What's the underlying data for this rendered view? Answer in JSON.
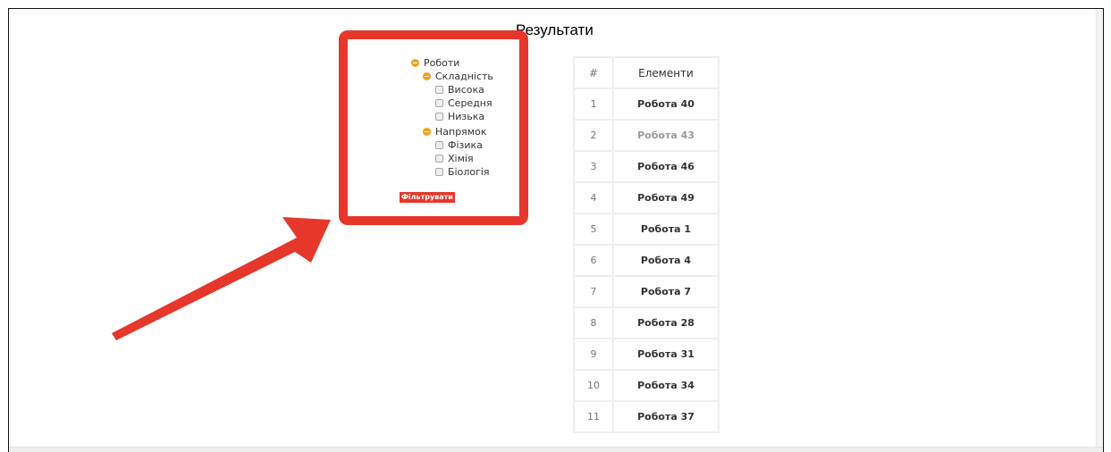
{
  "page": {
    "title": "Результати"
  },
  "filter_tree": {
    "root_label": "Роботи",
    "groups": [
      {
        "label": "Складність",
        "options": [
          "Висока",
          "Середня",
          "Низька"
        ]
      },
      {
        "label": "Напрямок",
        "options": [
          "Фізика",
          "Хімія",
          "Біологія"
        ]
      }
    ],
    "filter_button_label": "Фільтрувати"
  },
  "table": {
    "headers": [
      "#",
      "Елементи"
    ],
    "rows": [
      {
        "num": "1",
        "item": "Робота 40"
      },
      {
        "num": "2",
        "item": "Робота 43"
      },
      {
        "num": "3",
        "item": "Робота 46"
      },
      {
        "num": "4",
        "item": "Робота 49"
      },
      {
        "num": "5",
        "item": "Робота 1"
      },
      {
        "num": "6",
        "item": "Робота 4"
      },
      {
        "num": "7",
        "item": "Робота 7"
      },
      {
        "num": "8",
        "item": "Робота 28"
      },
      {
        "num": "9",
        "item": "Робота 31"
      },
      {
        "num": "10",
        "item": "Робота 34"
      },
      {
        "num": "11",
        "item": "Робота 37"
      }
    ]
  },
  "annotation": {
    "highlight_color": "#e5372a",
    "accent_color": "#f0a020",
    "icons": [
      "minus-circle-icon",
      "checkbox-icon",
      "arrow-icon"
    ]
  }
}
